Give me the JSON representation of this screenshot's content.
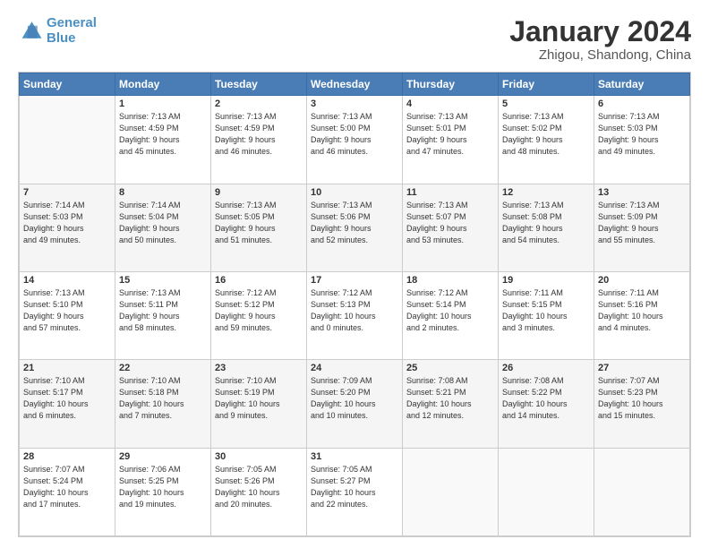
{
  "logo": {
    "line1": "General",
    "line2": "Blue"
  },
  "title": "January 2024",
  "subtitle": "Zhigou, Shandong, China",
  "headers": [
    "Sunday",
    "Monday",
    "Tuesday",
    "Wednesday",
    "Thursday",
    "Friday",
    "Saturday"
  ],
  "weeks": [
    [
      {
        "date": "",
        "info": ""
      },
      {
        "date": "1",
        "info": "Sunrise: 7:13 AM\nSunset: 4:59 PM\nDaylight: 9 hours\nand 45 minutes."
      },
      {
        "date": "2",
        "info": "Sunrise: 7:13 AM\nSunset: 4:59 PM\nDaylight: 9 hours\nand 46 minutes."
      },
      {
        "date": "3",
        "info": "Sunrise: 7:13 AM\nSunset: 5:00 PM\nDaylight: 9 hours\nand 46 minutes."
      },
      {
        "date": "4",
        "info": "Sunrise: 7:13 AM\nSunset: 5:01 PM\nDaylight: 9 hours\nand 47 minutes."
      },
      {
        "date": "5",
        "info": "Sunrise: 7:13 AM\nSunset: 5:02 PM\nDaylight: 9 hours\nand 48 minutes."
      },
      {
        "date": "6",
        "info": "Sunrise: 7:13 AM\nSunset: 5:03 PM\nDaylight: 9 hours\nand 49 minutes."
      }
    ],
    [
      {
        "date": "7",
        "info": "Sunrise: 7:14 AM\nSunset: 5:03 PM\nDaylight: 9 hours\nand 49 minutes."
      },
      {
        "date": "8",
        "info": "Sunrise: 7:14 AM\nSunset: 5:04 PM\nDaylight: 9 hours\nand 50 minutes."
      },
      {
        "date": "9",
        "info": "Sunrise: 7:13 AM\nSunset: 5:05 PM\nDaylight: 9 hours\nand 51 minutes."
      },
      {
        "date": "10",
        "info": "Sunrise: 7:13 AM\nSunset: 5:06 PM\nDaylight: 9 hours\nand 52 minutes."
      },
      {
        "date": "11",
        "info": "Sunrise: 7:13 AM\nSunset: 5:07 PM\nDaylight: 9 hours\nand 53 minutes."
      },
      {
        "date": "12",
        "info": "Sunrise: 7:13 AM\nSunset: 5:08 PM\nDaylight: 9 hours\nand 54 minutes."
      },
      {
        "date": "13",
        "info": "Sunrise: 7:13 AM\nSunset: 5:09 PM\nDaylight: 9 hours\nand 55 minutes."
      }
    ],
    [
      {
        "date": "14",
        "info": "Sunrise: 7:13 AM\nSunset: 5:10 PM\nDaylight: 9 hours\nand 57 minutes."
      },
      {
        "date": "15",
        "info": "Sunrise: 7:13 AM\nSunset: 5:11 PM\nDaylight: 9 hours\nand 58 minutes."
      },
      {
        "date": "16",
        "info": "Sunrise: 7:12 AM\nSunset: 5:12 PM\nDaylight: 9 hours\nand 59 minutes."
      },
      {
        "date": "17",
        "info": "Sunrise: 7:12 AM\nSunset: 5:13 PM\nDaylight: 10 hours\nand 0 minutes."
      },
      {
        "date": "18",
        "info": "Sunrise: 7:12 AM\nSunset: 5:14 PM\nDaylight: 10 hours\nand 2 minutes."
      },
      {
        "date": "19",
        "info": "Sunrise: 7:11 AM\nSunset: 5:15 PM\nDaylight: 10 hours\nand 3 minutes."
      },
      {
        "date": "20",
        "info": "Sunrise: 7:11 AM\nSunset: 5:16 PM\nDaylight: 10 hours\nand 4 minutes."
      }
    ],
    [
      {
        "date": "21",
        "info": "Sunrise: 7:10 AM\nSunset: 5:17 PM\nDaylight: 10 hours\nand 6 minutes."
      },
      {
        "date": "22",
        "info": "Sunrise: 7:10 AM\nSunset: 5:18 PM\nDaylight: 10 hours\nand 7 minutes."
      },
      {
        "date": "23",
        "info": "Sunrise: 7:10 AM\nSunset: 5:19 PM\nDaylight: 10 hours\nand 9 minutes."
      },
      {
        "date": "24",
        "info": "Sunrise: 7:09 AM\nSunset: 5:20 PM\nDaylight: 10 hours\nand 10 minutes."
      },
      {
        "date": "25",
        "info": "Sunrise: 7:08 AM\nSunset: 5:21 PM\nDaylight: 10 hours\nand 12 minutes."
      },
      {
        "date": "26",
        "info": "Sunrise: 7:08 AM\nSunset: 5:22 PM\nDaylight: 10 hours\nand 14 minutes."
      },
      {
        "date": "27",
        "info": "Sunrise: 7:07 AM\nSunset: 5:23 PM\nDaylight: 10 hours\nand 15 minutes."
      }
    ],
    [
      {
        "date": "28",
        "info": "Sunrise: 7:07 AM\nSunset: 5:24 PM\nDaylight: 10 hours\nand 17 minutes."
      },
      {
        "date": "29",
        "info": "Sunrise: 7:06 AM\nSunset: 5:25 PM\nDaylight: 10 hours\nand 19 minutes."
      },
      {
        "date": "30",
        "info": "Sunrise: 7:05 AM\nSunset: 5:26 PM\nDaylight: 10 hours\nand 20 minutes."
      },
      {
        "date": "31",
        "info": "Sunrise: 7:05 AM\nSunset: 5:27 PM\nDaylight: 10 hours\nand 22 minutes."
      },
      {
        "date": "",
        "info": ""
      },
      {
        "date": "",
        "info": ""
      },
      {
        "date": "",
        "info": ""
      }
    ]
  ]
}
